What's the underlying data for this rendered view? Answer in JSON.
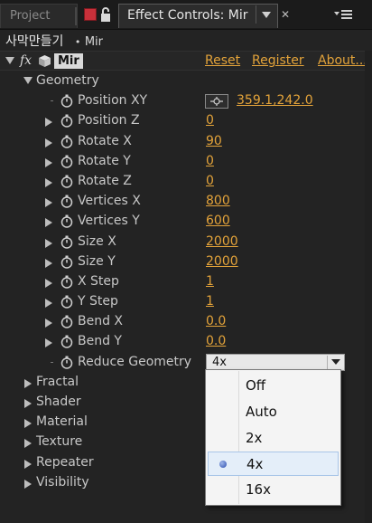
{
  "tabs": {
    "project_label": "Project",
    "effect_controls_label": "Effect Controls: Mir"
  },
  "layer": {
    "comp_name": "사막만들기",
    "layer_name": "Mir"
  },
  "effect": {
    "name": "Mir",
    "reset_label": "Reset",
    "register_label": "Register",
    "about_label": "About..."
  },
  "geometry": {
    "label": "Geometry",
    "position_xy": {
      "label": "Position XY",
      "value": "359.1,242.0"
    },
    "params": [
      {
        "label": "Position Z",
        "value": "0"
      },
      {
        "label": "Rotate X",
        "value": "90"
      },
      {
        "label": "Rotate Y",
        "value": "0"
      },
      {
        "label": "Rotate Z",
        "value": "0"
      },
      {
        "label": "Vertices X",
        "value": "800"
      },
      {
        "label": "Vertices Y",
        "value": "600"
      },
      {
        "label": "Size X",
        "value": "2000"
      },
      {
        "label": "Size Y",
        "value": "2000"
      },
      {
        "label": "X Step",
        "value": "1"
      },
      {
        "label": "Y Step",
        "value": "1"
      },
      {
        "label": "Bend X",
        "value": "0.0"
      },
      {
        "label": "Bend Y",
        "value": "0.0"
      }
    ],
    "reduce_geometry": {
      "label": "Reduce Geometry",
      "value": "4x"
    }
  },
  "groups": [
    "Fractal",
    "Shader",
    "Material",
    "Texture",
    "Repeater",
    "Visibility"
  ],
  "dropdown": {
    "options": [
      "Off",
      "Auto",
      "2x",
      "4x",
      "16x"
    ],
    "selected": "4x"
  },
  "colors": {
    "accent": "#e3a33a",
    "panel_bg": "#232323",
    "close_swatch": "#c8303a"
  }
}
